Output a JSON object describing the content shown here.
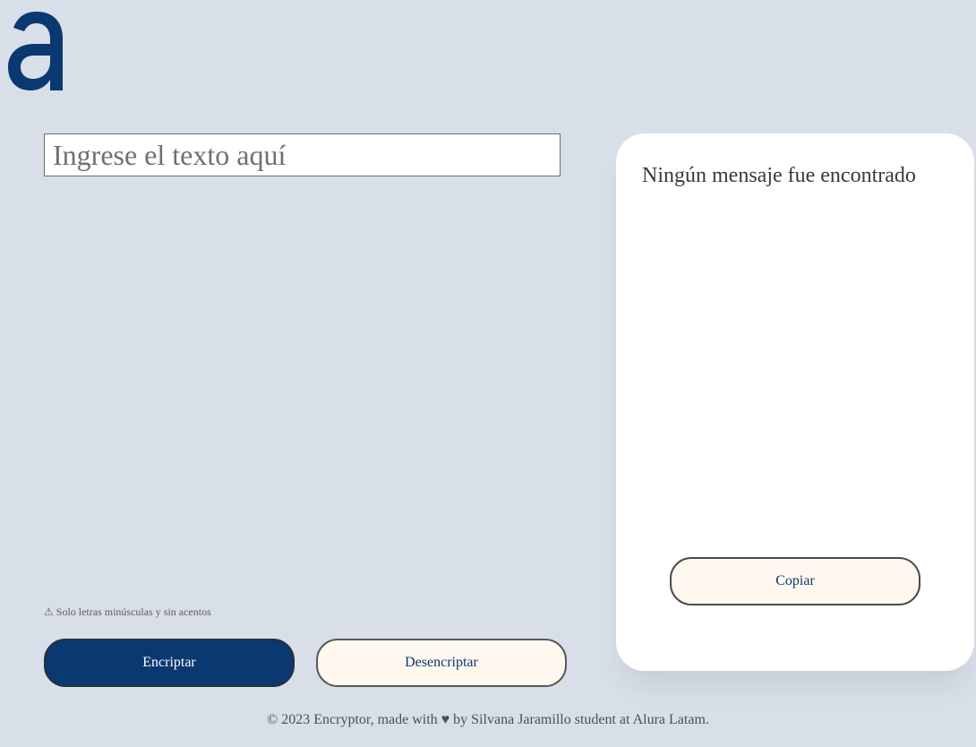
{
  "logo": {
    "icon": "alura-logo-icon",
    "color": "#0a3871"
  },
  "input": {
    "placeholder": "Ingrese el texto aquí",
    "value": ""
  },
  "warning": {
    "icon": "⚠",
    "text": "Solo letras minúsculas y sin acentos"
  },
  "buttons": {
    "encrypt_label": "Encriptar",
    "decrypt_label": "Desencriptar",
    "copy_label": "Copiar"
  },
  "output": {
    "message": "Ningún mensaje fue encontrado"
  },
  "footer": {
    "text": "© 2023 Encryptor, made with ♥ by Silvana Jaramillo student at Alura Latam."
  },
  "colors": {
    "background": "#d8dfe9",
    "primary": "#0a3871",
    "secondary_button": "#fff8ee",
    "card": "#ffffff"
  }
}
